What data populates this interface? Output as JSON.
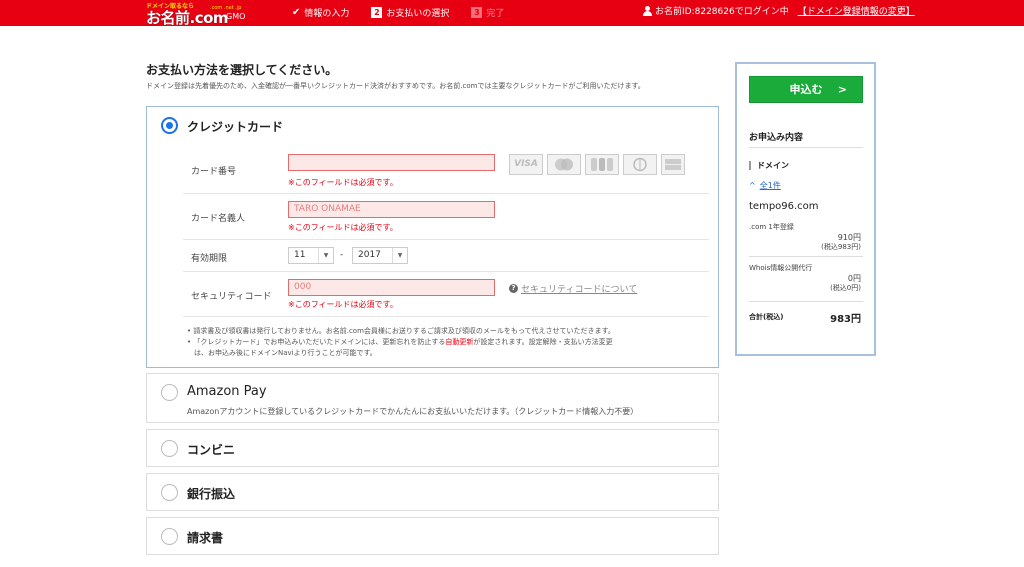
{
  "header": {
    "logo_tagline": "ドメイン取るなら",
    "logo_main": "お名前.com",
    "logo_sub": ".com .net .jp",
    "logo_gmo": "GMO",
    "steps": [
      {
        "label": "情報の入力",
        "state": "done"
      },
      {
        "num": "2",
        "label": "お支払いの選択",
        "state": "current"
      },
      {
        "num": "3",
        "label": "完了",
        "state": "pending"
      }
    ],
    "login_text": "お名前ID:8228626でログイン中",
    "domain_info_link": "ドメイン登録情報の変更"
  },
  "main": {
    "title": "お支払い方法を選択してください。",
    "description": "ドメイン登録は先着優先のため、入金確認が一番早いクレジットカード決済がおすすめです。お名前.comでは主要なクレジットカードがご利用いただけます。"
  },
  "credit_card": {
    "label": "クレジットカード",
    "selected": true,
    "card_number": {
      "label": "カード番号",
      "placeholder": "",
      "error": "※このフィールドは必須です。"
    },
    "card_brands": [
      {
        "name": "visa-logo",
        "text": "VISA"
      },
      {
        "name": "mastercard-logo",
        "text": ""
      },
      {
        "name": "jcb-logo",
        "text": ""
      },
      {
        "name": "diners-logo",
        "text": ""
      },
      {
        "name": "amex-logo",
        "text": ""
      }
    ],
    "card_holder": {
      "label": "カード名義人",
      "placeholder": "TARO ONAMAE",
      "error": "※このフィールドは必須です。"
    },
    "expiry": {
      "label": "有効期限",
      "month": "11",
      "separator": "-",
      "year": "2017"
    },
    "security_code": {
      "label": "セキュリティコード",
      "placeholder": "000",
      "error": "※このフィールドは必須です。",
      "help_link": "セキュリティコードについて"
    },
    "notes": {
      "line1": "• 請求書及び領収書は発行しておりません。お名前.com会員様にお送りするご請求及び領収のメールをもって代えさせていただきます。",
      "line2_pre": "• 「クレジットカード」でお申込みいただいたドメインには、更新忘れを防止する",
      "line2_auto": "自動更新",
      "line2_post": "が設定されます。設定解除・支払い方法変更",
      "line3": "は、お申込み後にドメインNaviより行うことが可能です。"
    }
  },
  "other_methods": [
    {
      "label": "Amazon Pay",
      "desc": "Amazonアカウントに登録しているクレジットカードでかんたんにお支払いいただけます。（クレジットカード情報入力不要）"
    },
    {
      "label": "コンビニ"
    },
    {
      "label": "銀行振込"
    },
    {
      "label": "請求書"
    }
  ],
  "sidebar": {
    "apply_button": "申込む",
    "summary_title": "お申込み内容",
    "category": "ドメイン",
    "toggle_icon": "^",
    "count_label": "全1件",
    "domain": "tempo96.com",
    "items": [
      {
        "name": ".com 1年登録",
        "price": "910円",
        "tax_incl": "(税込983円)"
      },
      {
        "name": "Whois情報公開代行",
        "price": "0円",
        "tax_incl": "(税込0円)"
      }
    ],
    "total_label": "合計(税込)",
    "total": "983円"
  },
  "colors": {
    "header_red": "#e60012",
    "apply_green": "#1aab3a",
    "radio_blue": "#1a73e8",
    "error_red": "#e60012"
  }
}
